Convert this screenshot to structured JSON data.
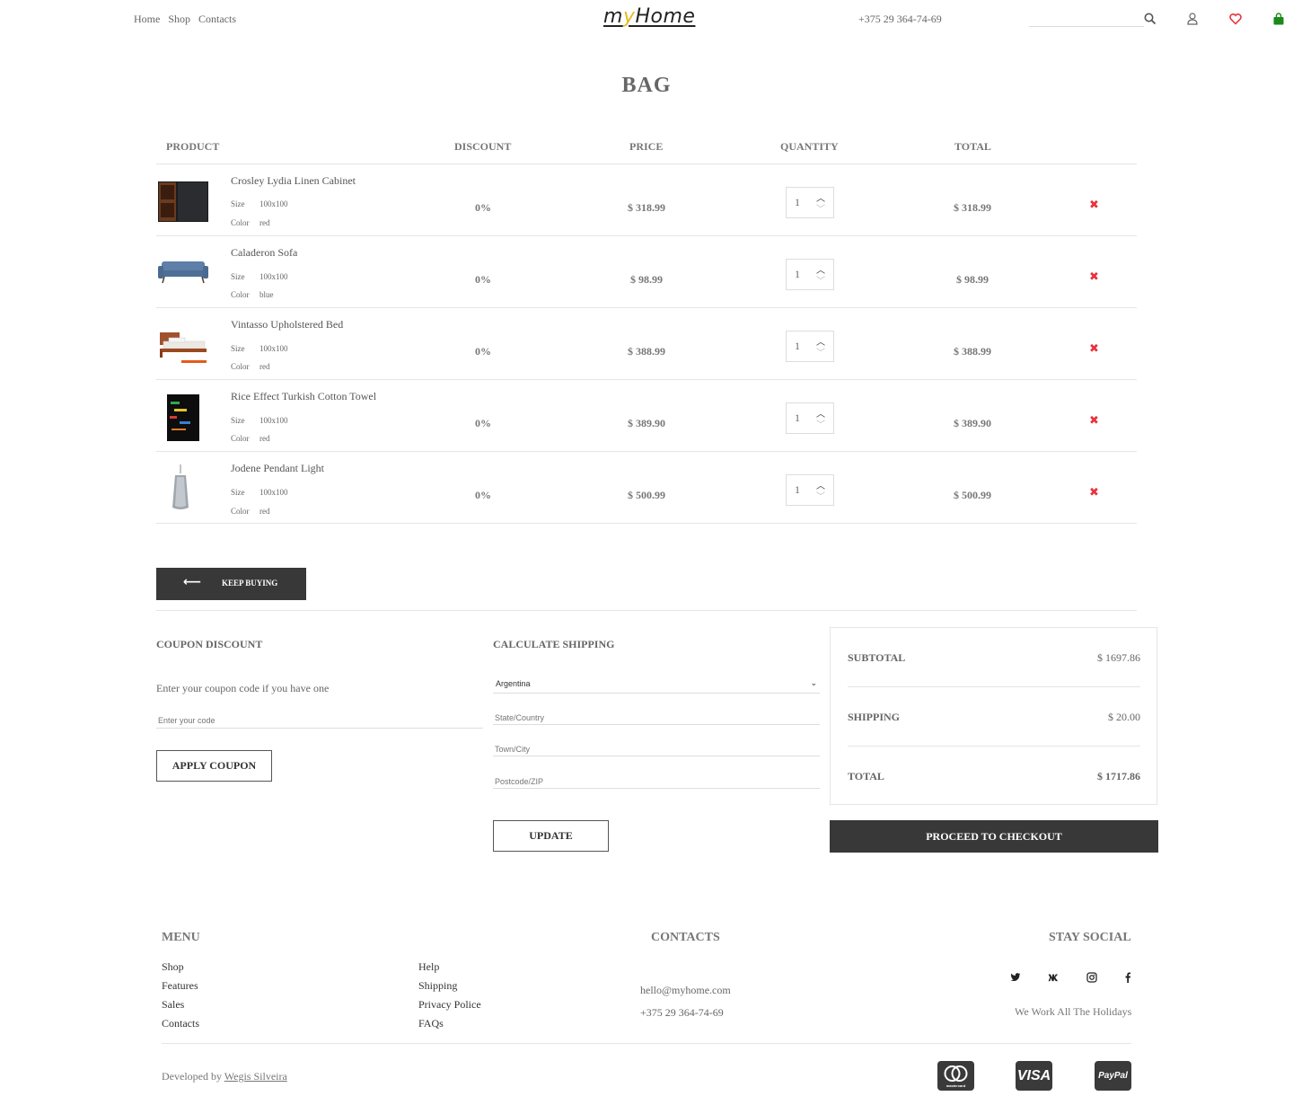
{
  "header": {
    "nav": [
      "Home",
      "Shop",
      "Contacts"
    ],
    "logo_part1": "m",
    "logo_part2": "y",
    "logo_part3": "Home",
    "phone": "+375 29 364-74-69"
  },
  "page_title": "BAG",
  "table": {
    "headers": [
      "PRODUCT",
      "DISCOUNT",
      "PRICE",
      "QUANTITY",
      "TOTAL"
    ],
    "size_label": "Size",
    "color_label": "Color",
    "rows": [
      {
        "name": "Crosley Lydia Linen Cabinet",
        "size": "100x100",
        "color": "red",
        "discount": "0%",
        "price": "$ 318.99",
        "qty": "1",
        "total": "$ 318.99",
        "thumb": "cabinet"
      },
      {
        "name": "Caladeron Sofa",
        "size": "100x100",
        "color": "blue",
        "discount": "0%",
        "price": "$ 98.99",
        "qty": "1",
        "total": "$ 98.99",
        "thumb": "sofa"
      },
      {
        "name": "Vintasso Upholstered Bed",
        "size": "100x100",
        "color": "red",
        "discount": "0%",
        "price": "$ 388.99",
        "qty": "1",
        "total": "$ 388.99",
        "thumb": "bed"
      },
      {
        "name": "Rice Effect Turkish Cotton Towel",
        "size": "100x100",
        "color": "red",
        "discount": "0%",
        "price": "$ 389.90",
        "qty": "1",
        "total": "$ 389.90",
        "thumb": "towel"
      },
      {
        "name": "Jodene Pendant Light",
        "size": "100x100",
        "color": "red",
        "discount": "0%",
        "price": "$ 500.99",
        "qty": "1",
        "total": "$ 500.99",
        "thumb": "lamp"
      }
    ]
  },
  "keep_buying": "KEEP BUYING",
  "coupon": {
    "title": "COUPON DISCOUNT",
    "description": "Enter your coupon code if you have one",
    "placeholder": "Enter your code",
    "button": "APPLY COUPON"
  },
  "shipping": {
    "title": "CALCULATE SHIPPING",
    "country": "Argentina",
    "state_placeholder": "State/Country",
    "town_placeholder": "Town/City",
    "zip_placeholder": "Postcode/ZIP",
    "button": "UPDATE"
  },
  "summary": {
    "subtotal_label": "SUBTOTAL",
    "subtotal": "$ 1697.86",
    "shipping_label": "SHIPPING",
    "shipping": "$ 20.00",
    "total_label": "TOTAL",
    "total": "$ 1717.86",
    "checkout": "PROCEED TO CHECKOUT"
  },
  "footer": {
    "menu_title": "MENU",
    "menu_col1": [
      "Shop",
      "Features",
      "Sales",
      "Contacts"
    ],
    "menu_col2": [
      "Help",
      "Shipping",
      "Privacy Police",
      "FAQs"
    ],
    "contacts_title": "CONTACTS",
    "email": "hello@myhome.com",
    "phone": "+375 29 364-74-69",
    "social_title": "STAY SOCIAL",
    "social_icons": [
      "twitter-icon",
      "vk-icon",
      "instagram-icon",
      "facebook-icon"
    ],
    "holidays": "We Work All The Holidays",
    "developed_by": "Developed by",
    "developer": "Wegis Silveira",
    "payments": [
      "mastercard",
      "VISA",
      "PayPal"
    ]
  },
  "colors": {
    "dark_button": "#383838",
    "remove": "#e8333e",
    "heart": "#e8333e",
    "bag": "#1a8a1a",
    "logo_accent": "#e8b923"
  }
}
